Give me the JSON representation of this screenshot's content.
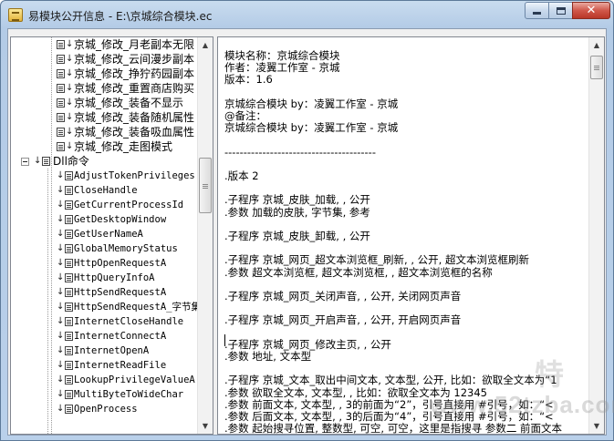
{
  "window": {
    "title": "易模块公开信息 - E:\\京城综合模块.ec",
    "close_glyph": "✕"
  },
  "tree": {
    "items_top": [
      "京城_修改_月老副本无限",
      "京城_修改_云间漫步副本",
      "京城_修改_挣狞药园副本",
      "京城_修改_重置商店购买",
      "京城_修改_装备不显示",
      "京城_修改_装备随机属性",
      "京城_修改_装备吸血属性",
      "京城_修改_走图模式"
    ],
    "group_label": "Dll命令",
    "dll_items": [
      "AdjustTokenPrivileges",
      "CloseHandle",
      "GetCurrentProcessId",
      "GetDesktopWindow",
      "GetUserNameA",
      "GlobalMemoryStatus",
      "HttpOpenRequestA",
      "HttpQueryInfoA",
      "HttpSendRequestA",
      "HttpSendRequestA_字节集",
      "InternetCloseHandle",
      "InternetConnectA",
      "InternetOpenA",
      "InternetReadFile",
      "LookupPrivilegeValueA",
      "MultiByteToWideChar",
      "OpenProcess"
    ]
  },
  "content": {
    "lines": [
      "模块名称：京城综合模块",
      "作者：凌翼工作室 - 京城",
      "版本：1.6",
      "",
      "京城综合模块      by：凌翼工作室 - 京城",
      "@备注：",
      "京城综合模块      by：凌翼工作室 - 京城",
      "",
      "----------------------------------------",
      "",
      ".版本 2",
      "",
      ".子程序 京城_皮肤_加载, , 公开",
      ".参数 加载的皮肤, 字节集, 参考",
      "",
      ".子程序 京城_皮肤_卸载, , 公开",
      "",
      ".子程序 京城_网页_超文本浏览框_刷新, , 公开, 超文本浏览框刷新",
      ".参数 超文本浏览框, 超文本浏览框, , 超文本浏览框的名称",
      "",
      ".子程序 京城_网页_关闭声音, , 公开, 关闭网页声音",
      "",
      ".子程序 京城_网页_开启声音, , 公开, 开启网页声音",
      "",
      ".子程序 京城_网页_修改主页, , 公开",
      ".参数 地址, 文本型",
      "",
      ".子程序 京城_文本_取出中间文本, 文本型, 公开, 比如：欲取全文本为“1",
      ".参数 欲取全文本, 文本型, , 比如：欲取全文本为 12345",
      ".参数 前面文本, 文本型, , 3的前面为“2”，引号直接用 #引号，如：“<",
      ".参数 后面文本, 文本型, , 3的后面为“4”，引号直接用 #引号，如：“<",
      ".参数 起始搜寻位置, 整数型, 可空, 可空，这里是指搜寻 参数二 前面文本"
    ]
  },
  "watermark": {
    "text": "www.52tzba.com",
    "cn_text": "特"
  }
}
